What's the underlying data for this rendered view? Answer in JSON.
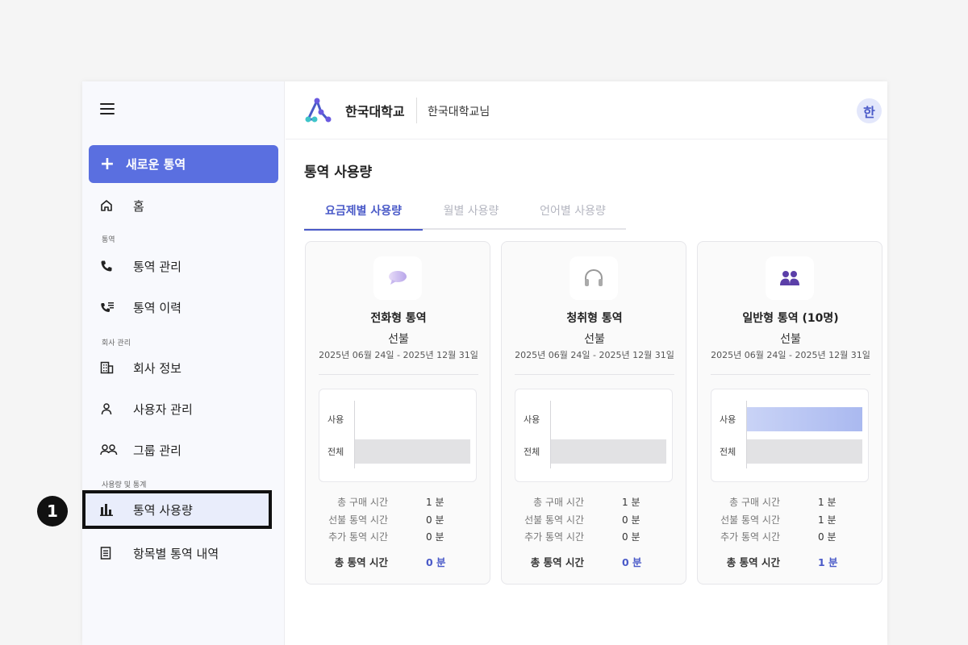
{
  "sidebar": {
    "new_call_label": "새로운 통역",
    "home_label": "홈",
    "section_interpret": "통역",
    "manage_label": "통역 관리",
    "history_label": "통역 이력",
    "section_company": "회사 관리",
    "company_info_label": "회사 정보",
    "user_manage_label": "사용자 관리",
    "group_manage_label": "그룹 관리",
    "section_usage": "사용량 및 통계",
    "usage_label": "통역 사용량",
    "itemized_label": "항목별 통역 내역"
  },
  "header": {
    "brand": "한국대학교",
    "user_name": "한국대학교님",
    "avatar_initial": "한"
  },
  "page": {
    "title": "통역 사용량",
    "tabs": [
      {
        "label": "요금제별 사용량",
        "active": true
      },
      {
        "label": "월별 사용량",
        "active": false
      },
      {
        "label": "언어별 사용량",
        "active": false
      }
    ]
  },
  "cards": [
    {
      "icon": "speech-bubble-icon",
      "name": "전화형 통역",
      "type": "선불",
      "period": "2025년 06월 24일 - 2025년 12월 31일",
      "chart_labels": {
        "used": "사용",
        "total": "전체"
      },
      "used_fraction": 0,
      "total_fraction": 1,
      "stats": [
        {
          "label": "총 구매 시간",
          "value": "1 분"
        },
        {
          "label": "선불 통역 시간",
          "value": "0 분"
        },
        {
          "label": "추가 통역 시간",
          "value": "0 분"
        }
      ],
      "total_label": "총 통역 시간",
      "total_value": "0 분"
    },
    {
      "icon": "headphones-icon",
      "name": "청취형 통역",
      "type": "선불",
      "period": "2025년 06월 24일 - 2025년 12월 31일",
      "chart_labels": {
        "used": "사용",
        "total": "전체"
      },
      "used_fraction": 0,
      "total_fraction": 1,
      "stats": [
        {
          "label": "총 구매 시간",
          "value": "1 분"
        },
        {
          "label": "선불 통역 시간",
          "value": "0 분"
        },
        {
          "label": "추가 통역 시간",
          "value": "0 분"
        }
      ],
      "total_label": "총 통역 시간",
      "total_value": "0 분"
    },
    {
      "icon": "group-people-icon",
      "name": "일반형 통역 (10명)",
      "type": "선불",
      "period": "2025년 06월 24일 - 2025년 12월 31일",
      "chart_labels": {
        "used": "사용",
        "total": "전체"
      },
      "used_fraction": 1,
      "total_fraction": 1,
      "stats": [
        {
          "label": "총 구매 시간",
          "value": "1 분"
        },
        {
          "label": "선불 통역 시간",
          "value": "1 분"
        },
        {
          "label": "추가 통역 시간",
          "value": "0 분"
        }
      ],
      "total_label": "총 통역 시간",
      "total_value": "1 분"
    }
  ],
  "annotation": {
    "step_number": "1"
  },
  "colors": {
    "accent": "#5a6fe0",
    "active_tab": "#4a5ac8",
    "used_bar": "#aab9f0",
    "total_bar": "#e2e2e4"
  }
}
